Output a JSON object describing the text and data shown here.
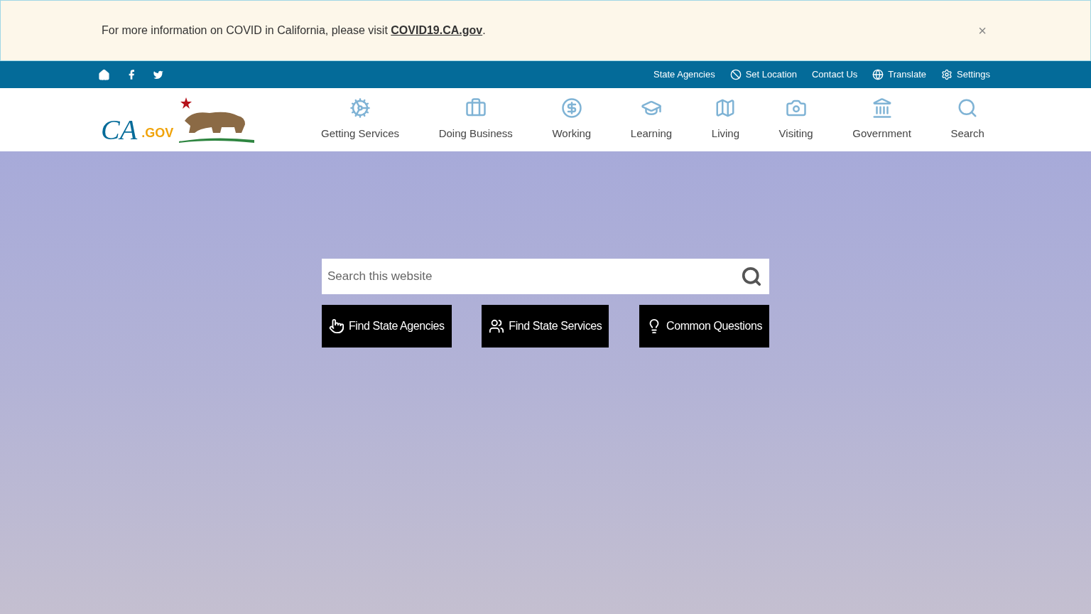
{
  "alert": {
    "text": "For more information on COVID in California, please visit ",
    "link": "COVID19.CA.gov",
    "after": ".",
    "close": "×"
  },
  "utility_bar": {
    "links": [
      {
        "label": "State Agencies"
      },
      {
        "label": "Set Location"
      },
      {
        "label": "Contact Us"
      },
      {
        "label": "Translate"
      },
      {
        "label": "Settings"
      }
    ]
  },
  "logo": {
    "text": "CA",
    "suffix": ".GOV"
  },
  "nav": [
    {
      "label": "Getting Services"
    },
    {
      "label": "Doing Business"
    },
    {
      "label": "Working"
    },
    {
      "label": "Learning"
    },
    {
      "label": "Living"
    },
    {
      "label": "Visiting"
    },
    {
      "label": "Government"
    },
    {
      "label": "Search"
    }
  ],
  "search": {
    "placeholder": "Search this website"
  },
  "buttons": [
    {
      "label": "Find State Agencies"
    },
    {
      "label": "Find State Services"
    },
    {
      "label": "Common Questions"
    }
  ]
}
